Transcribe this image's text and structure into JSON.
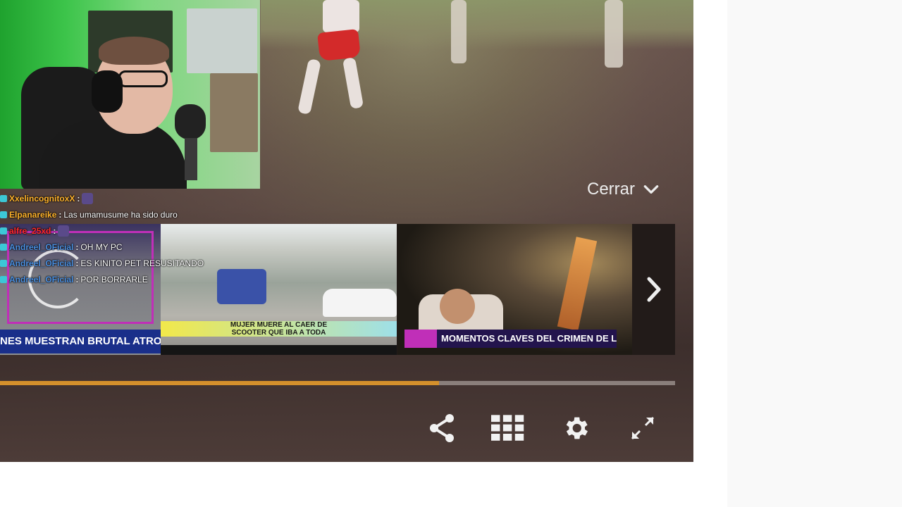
{
  "player": {
    "close_label": "Cerrar",
    "progress_fraction": 0.65
  },
  "chat": {
    "lines": [
      {
        "user": "XxelincognitoxX",
        "sep": " :",
        "msg": "",
        "user_color": "#ffb32b"
      },
      {
        "user": "Elpanareike",
        "sep": " :",
        "msg": "Las umamusume ha sido duro",
        "user_color": "#ffb32b"
      },
      {
        "user": "alfre_25xd",
        "sep": " :",
        "msg": "",
        "user_color": "#ff2a2a"
      },
      {
        "user": "Andreel_OFicial",
        "sep": " :",
        "msg": "OH MY PC",
        "user_color": "#4a8fe0"
      },
      {
        "user": "Andreel_OFicial",
        "sep": " :",
        "msg": "ES KINITO PET RESUSITANDO",
        "user_color": "#4a8fe0"
      },
      {
        "user": "Andreel_OFicial",
        "sep": " :",
        "msg": "POR BORRARLE",
        "user_color": "#4a8fe0"
      }
    ]
  },
  "related": {
    "items": [
      {
        "caption": "NES MUESTRAN BRUTAL ATROPELLO"
      },
      {
        "caption": "MUJER MUERE AL CAER DE SCOOTER QUE IBA A TODA VELOCIDAD"
      },
      {
        "caption": "MOMENTOS CLAVES DEL CRIMEN DE LIZETH"
      }
    ]
  },
  "controls": {
    "icons": [
      "share-icon",
      "grid-icon",
      "gear-icon",
      "fullscreen-icon"
    ]
  },
  "colors": {
    "progress_accent": "#d4902c",
    "progress_track": "#8a7f7b",
    "chat_badge": "#3cc7d6"
  }
}
